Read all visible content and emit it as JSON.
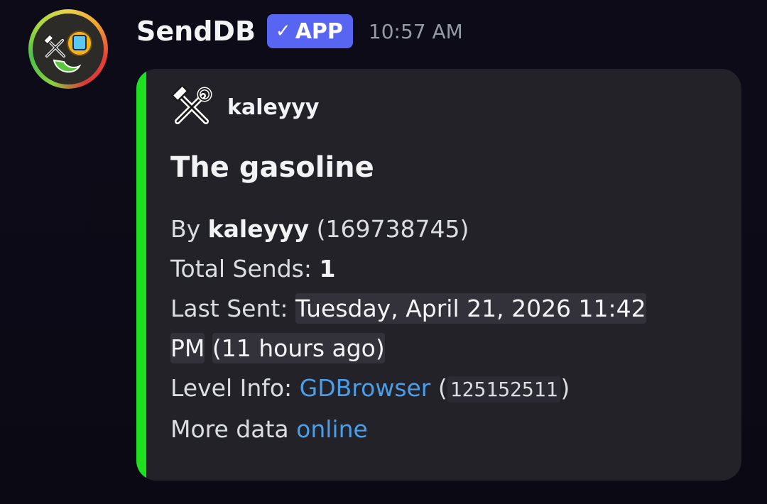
{
  "message": {
    "author": "SendDB",
    "badge": {
      "check": "✓",
      "label": "APP"
    },
    "timestamp": "10:57 AM"
  },
  "embed": {
    "accent_color": "#1fe01f",
    "author_icon": "hammer-wrench-icon",
    "author_name": "kaleyyy",
    "title": "The gasoline",
    "by_label": "By",
    "by_user": "kaleyyy",
    "by_id": "(169738745)",
    "sends_label": "Total Sends:",
    "sends_value": "1",
    "last_sent_label": "Last Sent:",
    "last_sent_date_part1": "Tuesday, April 21, 2026 11:42",
    "last_sent_date_part2": "PM",
    "last_sent_relative": "(11 hours ago)",
    "level_info_label": "Level Info:",
    "level_info_link": "GDBrowser",
    "level_id": "125152511",
    "more_data_label": "More data",
    "more_data_link": "online"
  },
  "colors": {
    "background": "#0d0b18",
    "embed_bg": "#232229",
    "badge": "#5865f2",
    "link": "#4a9ee8"
  }
}
